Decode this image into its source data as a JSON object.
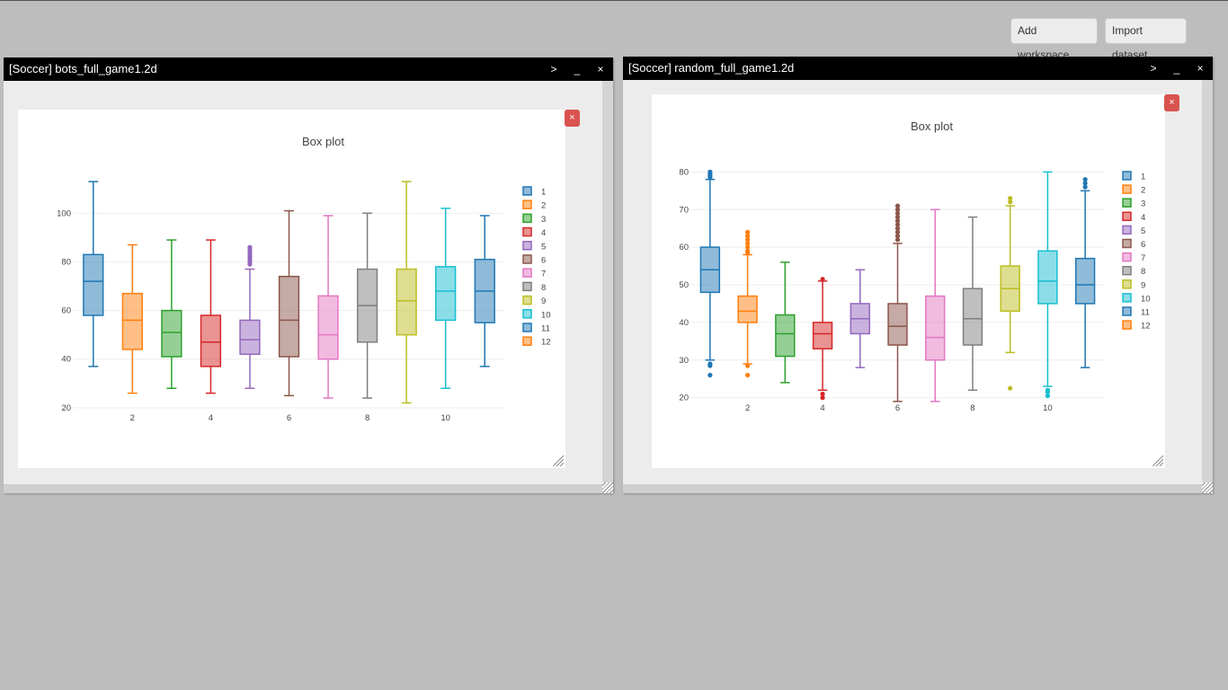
{
  "toolbar": {
    "add_workspace": "Add workspace",
    "import_dataset": "Import dataset"
  },
  "windows": [
    {
      "title": "[Soccer] bots_full_game1.2d",
      "controls": {
        "expand": ">",
        "minimize": "_",
        "close": "×"
      },
      "panel_close": "×",
      "chart_data": {
        "type": "box",
        "title": "Box plot",
        "xlabel": "",
        "ylabel": "",
        "xticks": [
          2,
          4,
          6,
          8,
          10
        ],
        "yticks": [
          20,
          40,
          60,
          80,
          100
        ],
        "ylim": [
          17,
          116
        ],
        "legend": [
          "1",
          "2",
          "3",
          "4",
          "5",
          "6",
          "7",
          "8",
          "9",
          "10",
          "11",
          "12"
        ],
        "legend_position": "right",
        "series": [
          {
            "x": 1,
            "min": 37,
            "q1": 58,
            "median": 72,
            "q3": 83,
            "max": 113,
            "outliers": []
          },
          {
            "x": 2,
            "min": 26,
            "q1": 44,
            "median": 56,
            "q3": 67,
            "max": 87,
            "outliers": []
          },
          {
            "x": 3,
            "min": 28,
            "q1": 41,
            "median": 51,
            "q3": 60,
            "max": 89,
            "outliers": []
          },
          {
            "x": 4,
            "min": 26,
            "q1": 37,
            "median": 47,
            "q3": 58,
            "max": 89,
            "outliers": []
          },
          {
            "x": 5,
            "min": 28,
            "q1": 42,
            "median": 48,
            "q3": 56,
            "max": 77,
            "outliers": [
              79,
              80,
              81,
              82,
              83,
              84,
              85,
              86
            ]
          },
          {
            "x": 6,
            "min": 25,
            "q1": 41,
            "median": 56,
            "q3": 74,
            "max": 101,
            "outliers": []
          },
          {
            "x": 7,
            "min": 24,
            "q1": 40,
            "median": 50,
            "q3": 66,
            "max": 99,
            "outliers": []
          },
          {
            "x": 8,
            "min": 24,
            "q1": 47,
            "median": 62,
            "q3": 77,
            "max": 100,
            "outliers": []
          },
          {
            "x": 9,
            "min": 22,
            "q1": 50,
            "median": 64,
            "q3": 77,
            "max": 113,
            "outliers": []
          },
          {
            "x": 10,
            "min": 28,
            "q1": 56,
            "median": 68,
            "q3": 78,
            "max": 102,
            "outliers": []
          },
          {
            "x": 11,
            "min": 37,
            "q1": 55,
            "median": 68,
            "q3": 81,
            "max": 99,
            "outliers": []
          }
        ]
      }
    },
    {
      "title": "[Soccer] random_full_game1.2d",
      "controls": {
        "expand": ">",
        "minimize": "_",
        "close": "×"
      },
      "panel_close": "×",
      "chart_data": {
        "type": "box",
        "title": "Box plot",
        "xlabel": "",
        "ylabel": "",
        "xticks": [
          2,
          4,
          6,
          8,
          10
        ],
        "yticks": [
          20,
          30,
          40,
          50,
          60,
          70,
          80
        ],
        "ylim": [
          18,
          82
        ],
        "legend": [
          "1",
          "2",
          "3",
          "4",
          "5",
          "6",
          "7",
          "8",
          "9",
          "10",
          "11",
          "12"
        ],
        "legend_position": "right",
        "series": [
          {
            "x": 1,
            "min": 30,
            "q1": 48,
            "median": 54,
            "q3": 60,
            "max": 78,
            "outliers": [
              26,
              28.5,
              29,
              78.5,
              79,
              79.5,
              80
            ]
          },
          {
            "x": 2,
            "min": 29,
            "q1": 40,
            "median": 43,
            "q3": 47,
            "max": 58,
            "outliers": [
              26,
              28.5,
              58.5,
              59,
              60,
              61,
              62,
              63,
              64
            ]
          },
          {
            "x": 3,
            "min": 24,
            "q1": 31,
            "median": 37,
            "q3": 42,
            "max": 56,
            "outliers": []
          },
          {
            "x": 4,
            "min": 22,
            "q1": 33,
            "median": 37,
            "q3": 40,
            "max": 51,
            "outliers": [
              20,
              21,
              51.5
            ]
          },
          {
            "x": 5,
            "min": 28,
            "q1": 37,
            "median": 41,
            "q3": 45,
            "max": 54,
            "outliers": []
          },
          {
            "x": 6,
            "min": 19,
            "q1": 34,
            "median": 39,
            "q3": 45,
            "max": 61,
            "outliers": [
              62,
              63,
              64,
              65,
              66,
              67,
              68,
              69,
              70,
              71
            ]
          },
          {
            "x": 7,
            "min": 19,
            "q1": 30,
            "median": 36,
            "q3": 47,
            "max": 70,
            "outliers": []
          },
          {
            "x": 8,
            "min": 22,
            "q1": 34,
            "median": 41,
            "q3": 49,
            "max": 68,
            "outliers": []
          },
          {
            "x": 9,
            "min": 32,
            "q1": 43,
            "median": 49,
            "q3": 55,
            "max": 71,
            "outliers": [
              22.5,
              72,
              73
            ]
          },
          {
            "x": 10,
            "min": 23,
            "q1": 45,
            "median": 51,
            "q3": 59,
            "max": 80,
            "outliers": [
              20.5,
              21.5,
              22
            ]
          },
          {
            "x": 11,
            "min": 28,
            "q1": 45,
            "median": 50,
            "q3": 57,
            "max": 75,
            "outliers": [
              76,
              77,
              78
            ]
          }
        ]
      }
    }
  ],
  "colors": {
    "palette": [
      "#1f77b4",
      "#ff7f0e",
      "#2ca02c",
      "#d62728",
      "#9467bd",
      "#8c564b",
      "#e377c2",
      "#7f7f7f",
      "#bcbd22",
      "#17becf",
      "#1f77b4",
      "#ff7f0e"
    ],
    "title_bar": "#000000",
    "close_button": "#d9534f"
  }
}
